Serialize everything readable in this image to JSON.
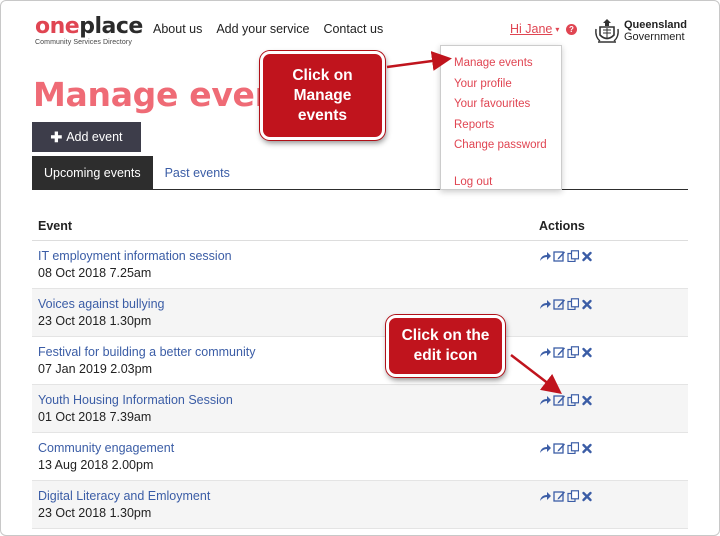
{
  "logo": {
    "part1": "one",
    "part2": "place",
    "sub": "Community Services Directory"
  },
  "nav": [
    "About us",
    "Add your service",
    "Contact us"
  ],
  "user": {
    "greeting": "Hi Jane"
  },
  "gov": {
    "line1": "Queensland",
    "line2": "Government"
  },
  "page_title": "Manage events",
  "add_button": "Add event",
  "tabs": [
    {
      "label": "Upcoming events"
    },
    {
      "label": "Past events"
    }
  ],
  "table": {
    "headers": [
      "Event",
      "Actions"
    ],
    "rows": [
      {
        "title": "IT employment information session",
        "date": "08 Oct 2018 7.25am"
      },
      {
        "title": "Voices against bullying",
        "date": "23 Oct 2018 1.30pm"
      },
      {
        "title": "Festival for building a better community",
        "date": "07 Jan 2019 2.03pm"
      },
      {
        "title": "Youth Housing Information Session",
        "date": "01 Oct 2018 7.39am"
      },
      {
        "title": "Community engagement",
        "date": "13 Aug 2018 2.00pm"
      },
      {
        "title": "Digital Literacy and Emloyment",
        "date": "23 Oct 2018 1.30pm"
      }
    ]
  },
  "dropdown": [
    "Manage events",
    "Your profile",
    "Your favourites",
    "Reports",
    "Change password",
    "Log out"
  ],
  "callouts": {
    "c1": [
      "Click on",
      "Manage",
      "events"
    ],
    "c2": [
      "Click on the",
      "edit icon"
    ]
  },
  "colors": {
    "accent": "#e04552",
    "title": "#ef6b76",
    "link": "#3b5da6",
    "icon": "#3b5da6",
    "callout": "#c0141d"
  },
  "action_icons": [
    "share-icon",
    "edit-icon",
    "copy-icon",
    "delete-icon"
  ]
}
